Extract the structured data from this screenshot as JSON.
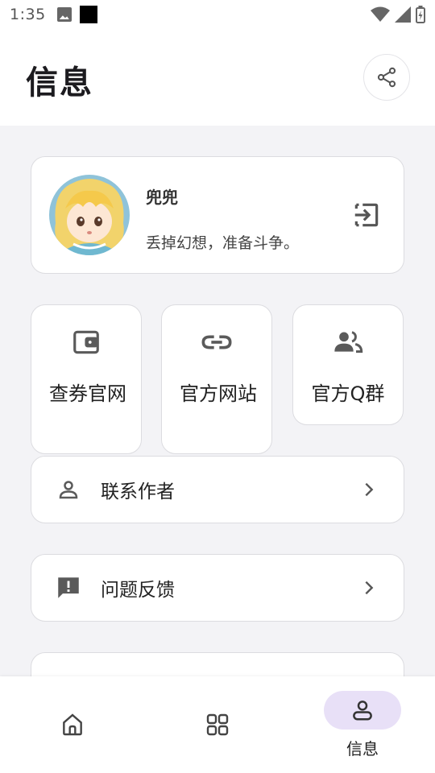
{
  "status_bar": {
    "time": "1:35"
  },
  "header": {
    "title": "信息"
  },
  "profile": {
    "name": "兜兜",
    "motto": "丢掉幻想，准备斗争。"
  },
  "grid": [
    {
      "label": "查券官网",
      "icon": "wallet-icon"
    },
    {
      "label": "官方网站",
      "icon": "link-icon"
    },
    {
      "label": "官方Q群",
      "icon": "group-icon"
    }
  ],
  "rows": [
    {
      "label": "联系作者",
      "icon": "person-icon"
    },
    {
      "label": "问题反馈",
      "icon": "feedback-icon"
    }
  ],
  "nav": [
    {
      "label": "",
      "icon": "home-icon"
    },
    {
      "label": "",
      "icon": "apps-icon"
    },
    {
      "label": "信息",
      "icon": "person-icon",
      "active": true
    }
  ],
  "colors": {
    "accent_pill": "#e8e0f7",
    "icon": "#5a5a5a"
  }
}
